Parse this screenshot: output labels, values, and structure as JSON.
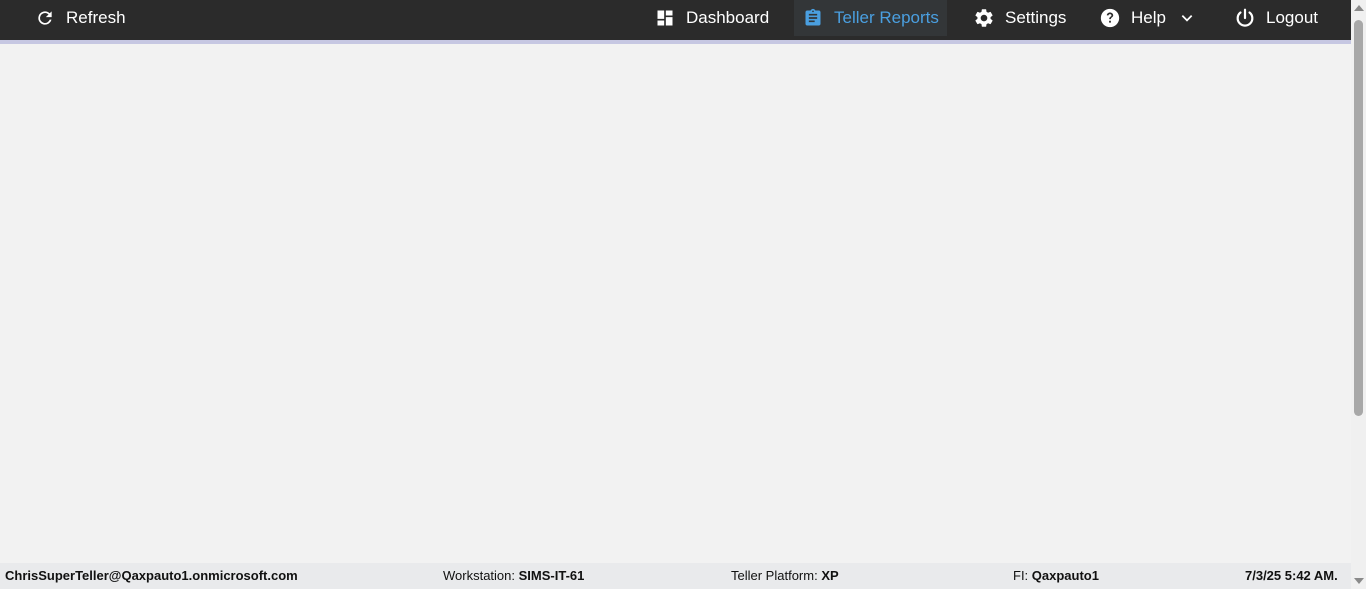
{
  "nav": {
    "refresh_label": "Refresh",
    "dashboard_label": "Dashboard",
    "reports_label": "Teller Reports",
    "settings_label": "Settings",
    "help_label": "Help",
    "logout_label": "Logout",
    "active_color": "#4a9fe0",
    "bar_color": "#2b2b2b"
  },
  "status": {
    "user": "ChrisSuperTeller@Qaxpauto1.onmicrosoft.com",
    "workstation_label": "Workstation:",
    "workstation_value": "SIMS-IT-61",
    "platform_label": "Teller Platform:",
    "platform_value": "XP",
    "fi_label": "FI:",
    "fi_value": "Qaxpauto1",
    "datetime": "7/3/25 5:42 AM."
  },
  "icons": [
    "refresh-icon",
    "dashboard-icon",
    "clipboard-icon",
    "gear-icon",
    "help-icon",
    "chevron-down-icon",
    "power-icon"
  ]
}
